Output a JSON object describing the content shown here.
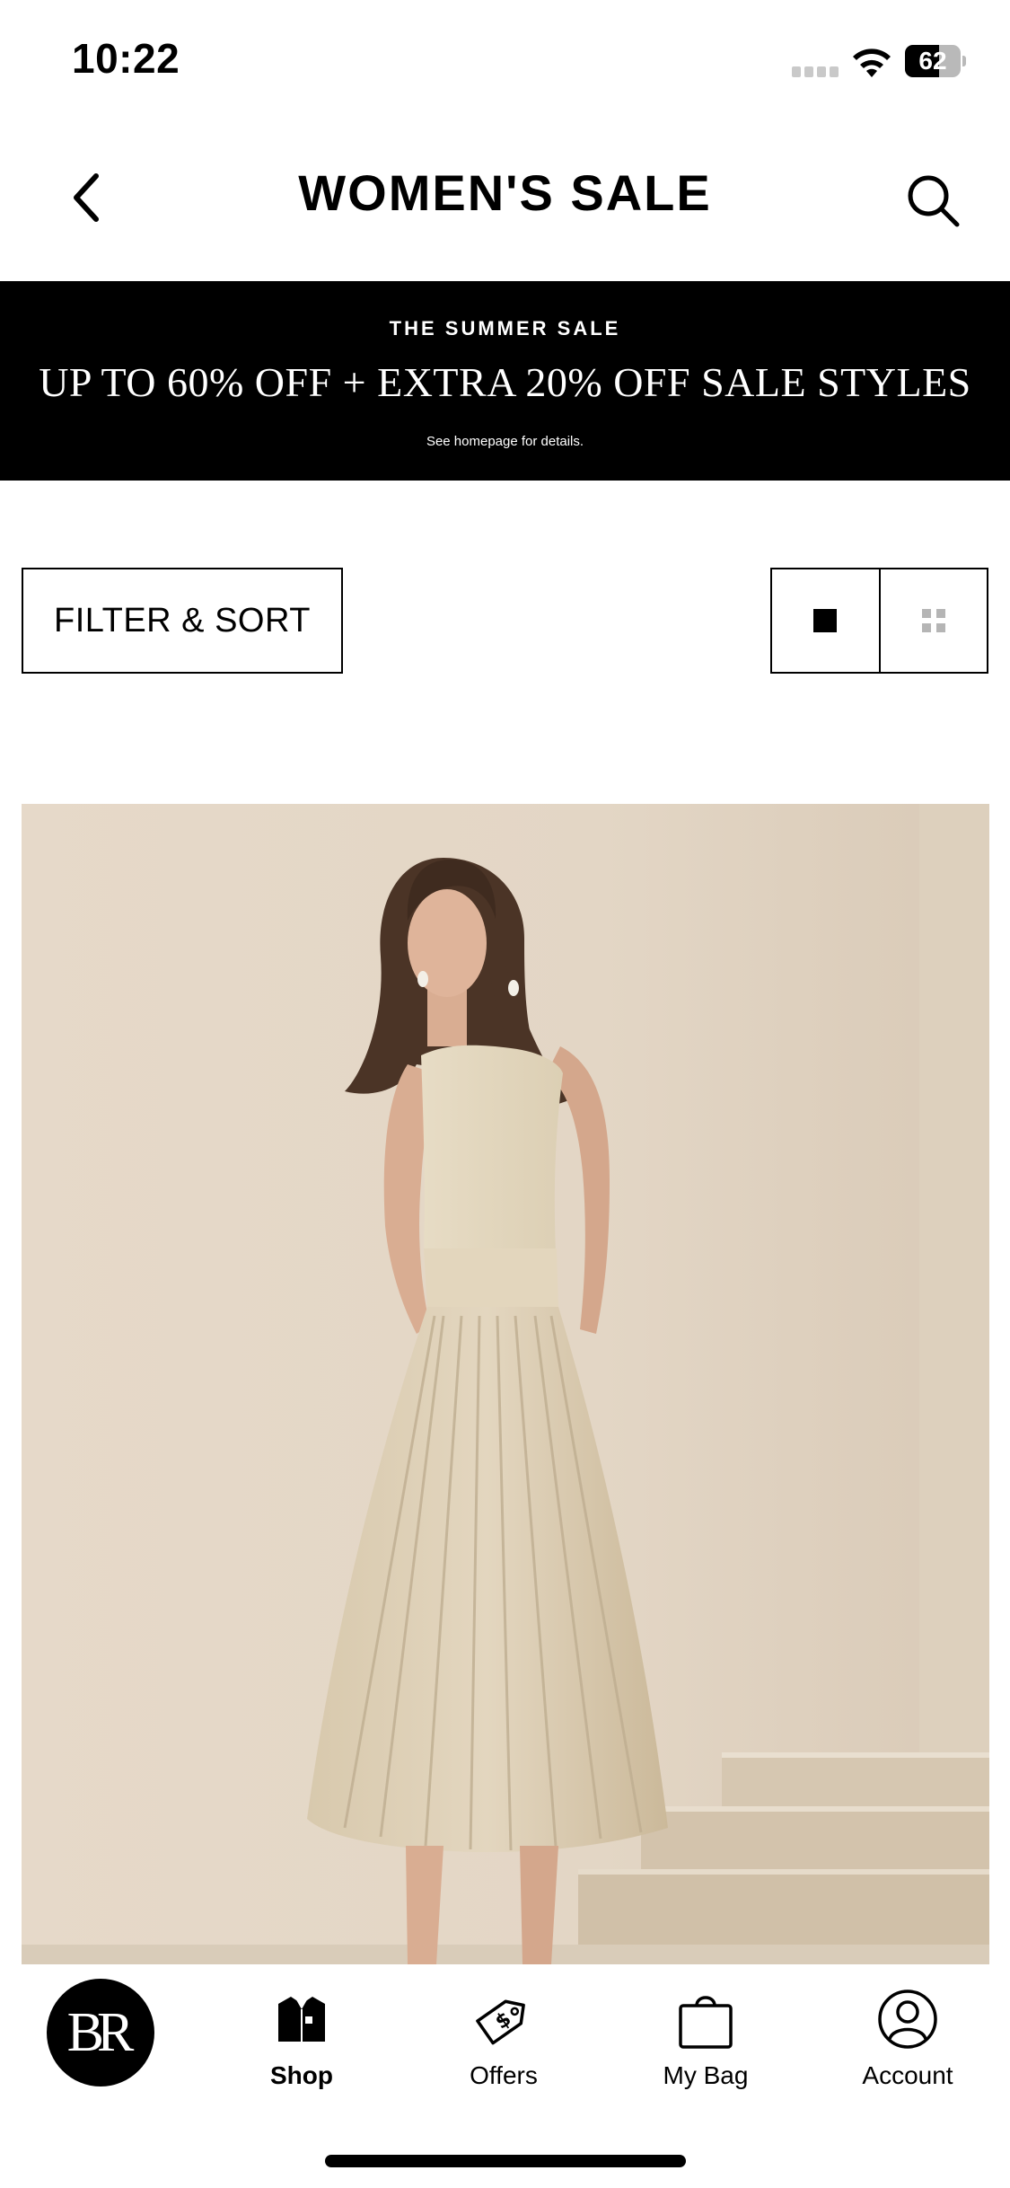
{
  "status_bar": {
    "time": "10:22",
    "battery_percent": "62",
    "battery_level": 0.62
  },
  "header": {
    "title": "WOMEN'S SALE"
  },
  "promo": {
    "eyebrow": "THE SUMMER SALE",
    "headline": "UP TO 60% OFF + EXTRA 20% OFF SALE STYLES",
    "fine_print": "See homepage for details."
  },
  "filter": {
    "label": "FILTER & SORT"
  },
  "view_toggle": {
    "options": [
      "single-column",
      "grid"
    ],
    "selected": "single-column"
  },
  "bottom_nav": {
    "logo_text": "BR",
    "items": [
      {
        "label": "Shop",
        "icon": "shirt-icon",
        "active": true
      },
      {
        "label": "Offers",
        "icon": "price-tag-icon",
        "active": false
      },
      {
        "label": "My Bag",
        "icon": "shopping-bag-icon",
        "active": false
      },
      {
        "label": "Account",
        "icon": "account-icon",
        "active": false
      }
    ]
  },
  "colors": {
    "background": "#ffffff",
    "banner": "#000000",
    "text": "#000000",
    "inactive_view_icon": "#b5b5b5",
    "photo_backdrop": "#e2d5c5"
  }
}
